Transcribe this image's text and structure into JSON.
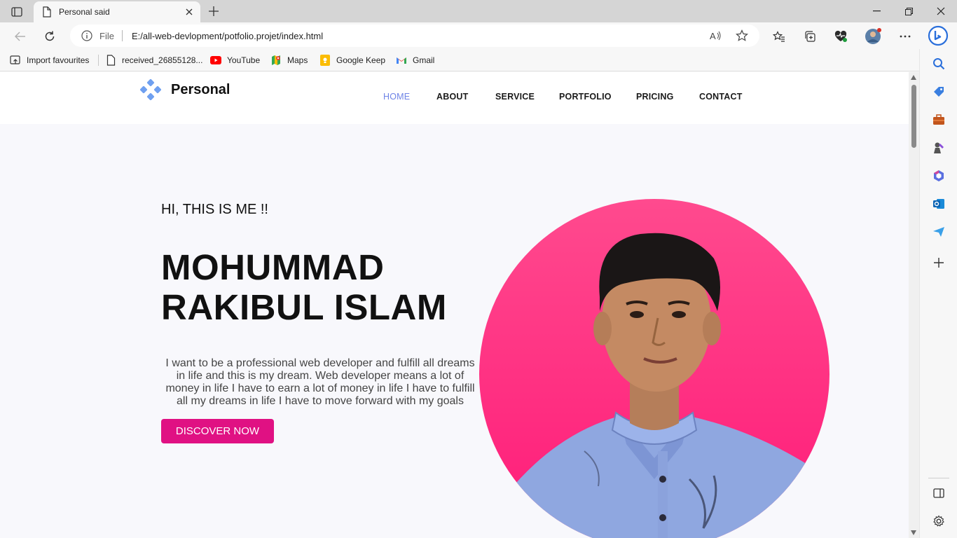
{
  "browser": {
    "tab_title": "Personal said",
    "address": {
      "scheme_label": "File",
      "url": "E:/all-web-devlopment/potfolio.projet/index.html"
    },
    "favourites": [
      {
        "label": "Import favourites",
        "icon": "import-icon"
      },
      {
        "label": "received_26855128...",
        "icon": "page-icon"
      },
      {
        "label": "YouTube",
        "icon": "youtube-icon"
      },
      {
        "label": "Maps",
        "icon": "maps-icon"
      },
      {
        "label": "Google Keep",
        "icon": "keep-icon"
      },
      {
        "label": "Gmail",
        "icon": "gmail-icon"
      }
    ]
  },
  "site": {
    "brand": "Personal",
    "nav": [
      {
        "label": "HOME",
        "active": true
      },
      {
        "label": "ABOUT",
        "active": false
      },
      {
        "label": "SERVICE",
        "active": false
      },
      {
        "label": "PORTFOLIO",
        "active": false
      },
      {
        "label": "PRICING",
        "active": false
      },
      {
        "label": "CONTACT",
        "active": false
      }
    ],
    "hero": {
      "greeting": "HI, THIS IS ME !!",
      "name_line1": "MOHUMMAD",
      "name_line2": "RAKIBUL ISLAM",
      "description": "I want to be a professional web developer and fulfill all dreams in life and this is my dream. Web developer means a lot of money in life I have to earn a lot of money in life I have to fulfill all my dreams in life I have to move forward with my goals",
      "cta": "DISCOVER NOW"
    }
  },
  "colors": {
    "nav_active": "#6f84e6",
    "cta_bg": "#e01183",
    "photo_circle_top": "#ff4a8e",
    "photo_circle_bottom": "#ff1a78",
    "logo_blue": "#6fa0f0"
  }
}
